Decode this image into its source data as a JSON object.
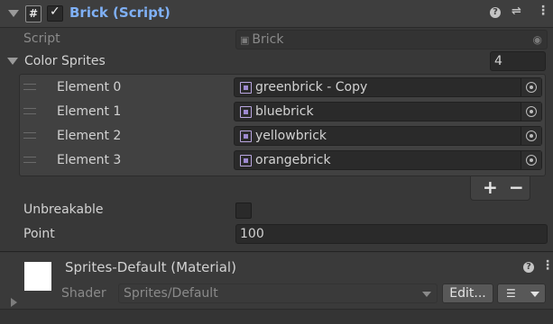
{
  "component": {
    "title": "Brick (Script)",
    "enabled": true,
    "script_label": "Script",
    "script_value": "Brick"
  },
  "color_sprites": {
    "label": "Color Sprites",
    "size": "4",
    "elements": [
      {
        "label": "Element 0",
        "value": "greenbrick - Copy"
      },
      {
        "label": "Element 1",
        "value": "bluebrick"
      },
      {
        "label": "Element 2",
        "value": "yellowbrick"
      },
      {
        "label": "Element 3",
        "value": "orangebrick"
      }
    ],
    "add_label": "+",
    "remove_label": "−"
  },
  "unbreakable": {
    "label": "Unbreakable",
    "checked": false
  },
  "point": {
    "label": "Point",
    "value": "100"
  },
  "material": {
    "title": "Sprites-Default (Material)",
    "swatch_color": "#ffffff",
    "shader_label": "Shader",
    "shader_value": "Sprites/Default",
    "edit_label": "Edit..."
  },
  "icons": [
    "script-icon",
    "help-icon",
    "preset-icon",
    "more-icon",
    "object-picker-icon",
    "sprite-icon",
    "list-icon",
    "drag-handle-icon"
  ],
  "colors": {
    "accent_title": "#7fb0f5",
    "background": "#383838",
    "field": "#2a2a2a"
  }
}
